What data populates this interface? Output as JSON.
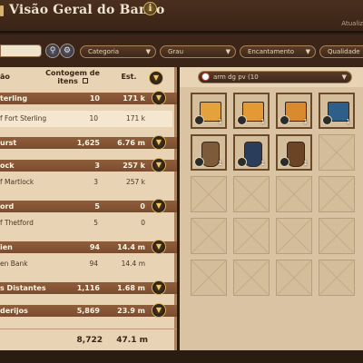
{
  "window": {
    "title": "Visão Geral do Banco",
    "subtitle": "Atualiz"
  },
  "filters": {
    "dropdowns": [
      "Categoria",
      "Grau",
      "Encantamento",
      "Qualidade"
    ]
  },
  "left_panel": {
    "headers": {
      "location": "ão",
      "item_count": "Contogem de itens",
      "estimate": "Est."
    },
    "rows": [
      {
        "type": "category",
        "name": "terling",
        "count": "10",
        "est": "171 k"
      },
      {
        "type": "item",
        "name": "f Fort Sterling",
        "count": "10",
        "est": "171 k",
        "highlight": true
      },
      {
        "type": "category",
        "name": "urst",
        "count": "1,625",
        "est": "6.76 m"
      },
      {
        "type": "category",
        "name": "ock",
        "count": "3",
        "est": "257 k"
      },
      {
        "type": "item",
        "name": "f Martlock",
        "count": "3",
        "est": "257 k",
        "highlight": false
      },
      {
        "type": "category",
        "name": "ord",
        "count": "5",
        "est": "0"
      },
      {
        "type": "item",
        "name": "f Thetford",
        "count": "5",
        "est": "0",
        "highlight": false
      },
      {
        "type": "category",
        "name": "ien",
        "count": "94",
        "est": "14.4 m"
      },
      {
        "type": "item",
        "name": "en Bank",
        "count": "94",
        "est": "14.4 m",
        "highlight": false
      },
      {
        "type": "category",
        "name": "s Distantes",
        "count": "1,116",
        "est": "1.68 m"
      },
      {
        "type": "category",
        "name": "derijos",
        "count": "5,869",
        "est": "23.9 m"
      }
    ],
    "totals": {
      "count": "8,722",
      "est": "47.1 m"
    }
  },
  "right_panel": {
    "bag_selector": "arm dg pv (10",
    "slots": [
      {
        "kind": "book",
        "color": "#e3a23c",
        "tier": "",
        "qty": "1"
      },
      {
        "kind": "book",
        "color": "#e39a35",
        "tier": "",
        "qty": "1"
      },
      {
        "kind": "book",
        "color": "#d98a2f",
        "tier": "",
        "qty": "1"
      },
      {
        "kind": "book",
        "color": "#2e5f8a",
        "tier": "",
        "qty": "1"
      },
      {
        "kind": "armor",
        "color": "#7c5a3a",
        "tier": "",
        "qty": "1"
      },
      {
        "kind": "armor",
        "color": "#2a3e5c",
        "tier": "",
        "qty": "1"
      },
      {
        "kind": "armor",
        "color": "#6a4424",
        "tier": "",
        "qty": "1"
      }
    ],
    "total_slots": 20
  },
  "colors": {
    "accent_gold": "#d8b15c",
    "panel_bg": "#e8d3b4",
    "category_row": "#8f5e3c"
  }
}
